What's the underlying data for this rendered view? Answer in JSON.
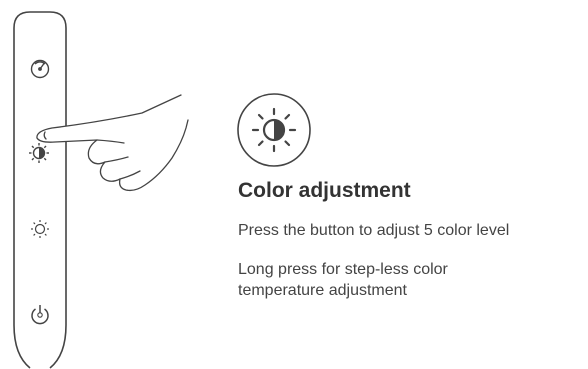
{
  "feature": {
    "icon": "brightness-half-icon",
    "title": "Color adjustment",
    "description_short_press": "Press the button to adjust 5 color level",
    "description_long_press": "Long press for step-less color temperature adjustment"
  },
  "panel": {
    "buttons": [
      {
        "icon": "dial-icon"
      },
      {
        "icon": "color-temperature-icon"
      },
      {
        "icon": "brightness-icon"
      },
      {
        "icon": "power-icon"
      }
    ]
  },
  "colors": {
    "line": "#444444",
    "text": "#444444"
  }
}
